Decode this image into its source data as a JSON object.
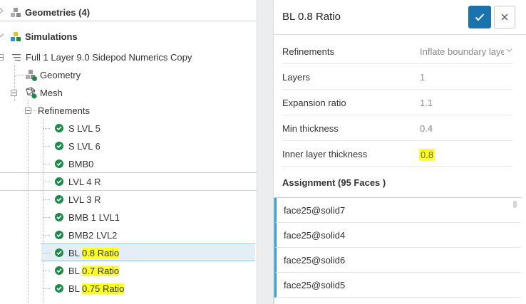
{
  "tree": {
    "geometries": {
      "label": "Geometries (4)"
    },
    "simulations": {
      "label": "Simulations"
    },
    "simulation": {
      "label": "Full 1 Layer 9.0 Sidepod Numerics Copy"
    },
    "geometry": {
      "label": "Geometry"
    },
    "mesh": {
      "label": "Mesh"
    },
    "refinements": {
      "label": "Refinements"
    },
    "items": [
      {
        "label": "S LVL 5"
      },
      {
        "label": "S LVL 6"
      },
      {
        "label": "BMB0"
      },
      {
        "label": "LVL 4 R"
      },
      {
        "label": "LVL 3 R"
      },
      {
        "label": "BMB 1 LVL1"
      },
      {
        "label": "BMB2 LVL2"
      },
      {
        "prefix": "BL ",
        "highlight": "0.8 Ratio"
      },
      {
        "prefix": "BL ",
        "highlight": "0.7 Ratio"
      },
      {
        "prefix": "BL ",
        "highlight": "0.75 Ratio"
      }
    ]
  },
  "panel": {
    "title": "BL 0.8 Ratio",
    "fields": [
      {
        "label": "Refinements",
        "value": "Inflate boundary laye"
      },
      {
        "label": "Layers",
        "value": "1"
      },
      {
        "label": "Expansion ratio",
        "value": "1.1"
      },
      {
        "label": "Min thickness",
        "value": "0.4"
      },
      {
        "label": "Inner layer thickness",
        "value": "0.8"
      }
    ],
    "assignment_title": "Assignment (95 Faces )",
    "assignment_items": [
      {
        "label": "face25@solid7"
      },
      {
        "label": "face25@solid4"
      },
      {
        "label": "face25@solid6"
      },
      {
        "label": "face25@solid5"
      }
    ]
  },
  "colors": {
    "accent": "#1a73ae",
    "success": "#1d8a4a",
    "highlight": "#ffff2e",
    "assignment_bar": "#2aa1d8"
  },
  "icons": {
    "confirm": "check-icon",
    "close": "close-icon",
    "status": "check-circle-icon",
    "geometry": "cubes-icon",
    "simulation": "simulation-icon",
    "mesh": "mesh-icon"
  }
}
